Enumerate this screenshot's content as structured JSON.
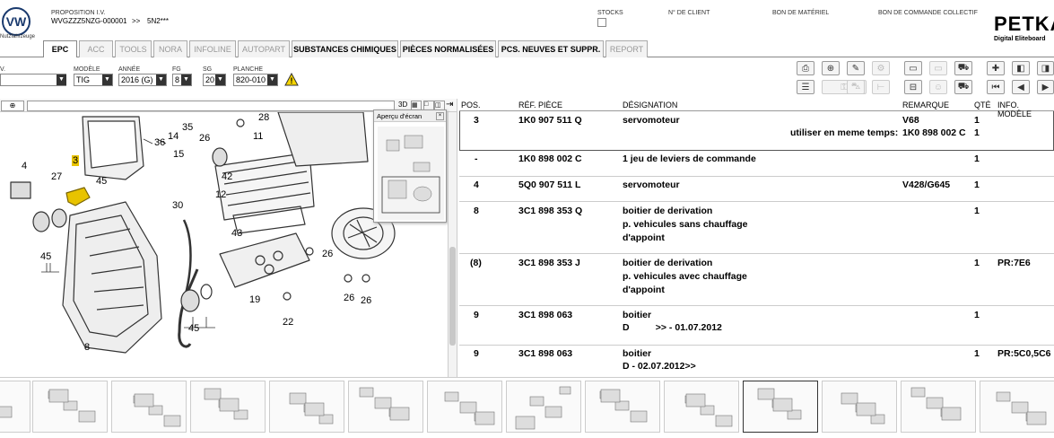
{
  "header": {
    "logo_sub": "Nutzfahrzeuge",
    "proposition_label": "PROPOSITION I.V.",
    "vin": "WVGZZZ5NZG-000001",
    "separator": ">>",
    "model_code": "5N2***",
    "stocks_label": "STOCKS",
    "client_label": "N° DE CLIENT",
    "materiel_label": "BON DE MATÉRIEL",
    "commande_label": "BON DE COMMANDE COLLECTIF",
    "petka": "PETKA",
    "petka_sub": "Digital Eliteboard"
  },
  "tabs": [
    {
      "label": "EPC",
      "state": "active"
    },
    {
      "label": "ACC",
      "state": "disabled"
    },
    {
      "label": "TOOLS",
      "state": "disabled"
    },
    {
      "label": "NORA",
      "state": "disabled"
    },
    {
      "label": "INFOLINE",
      "state": "disabled"
    },
    {
      "label": "AUTOPART",
      "state": "disabled"
    },
    {
      "label": "SUBSTANCES CHIMIQUES",
      "state": "enabled"
    },
    {
      "label": "PIÈCES NORMALISÉES",
      "state": "enabled"
    },
    {
      "label": "PCS. NEUVES ET SUPPR.",
      "state": "enabled"
    },
    {
      "label": "REPORT",
      "state": "disabled"
    }
  ],
  "selectors": {
    "v_label": "V.",
    "modele_label": "MODÈLE",
    "modele_value": "TIG",
    "annee_label": "ANNÉE",
    "annee_value": "2016 (G)",
    "fg_label": "FG",
    "fg_value": "8",
    "sg_label": "SG",
    "sg_value": "20",
    "planche_label": "PLANCHE",
    "planche_value": "820-010"
  },
  "preview": {
    "title": "Aperçu d'écran"
  },
  "table": {
    "headers": [
      "POS.",
      "RÉF. PIÈCE",
      "DÉSIGNATION",
      "REMARQUE",
      "QTÉ",
      "INFO. MODÈLE"
    ],
    "rows": [
      {
        "pos": "3",
        "ref": "1K0 907 511 Q",
        "desig": [
          "servomoteur"
        ],
        "remarque": "V68",
        "qty": "1",
        "info": "",
        "extra_label": "utiliser en meme temps:",
        "extra_ref": "1K0 898 002 C",
        "extra_qty": "1"
      },
      {
        "pos": "-",
        "ref": "1K0 898 002 C",
        "desig": [
          "1 jeu de leviers de commande"
        ],
        "remarque": "",
        "qty": "1",
        "info": ""
      },
      {
        "pos": "4",
        "ref": "5Q0 907 511 L",
        "desig": [
          "servomoteur"
        ],
        "remarque": "V428/G645",
        "qty": "1",
        "info": ""
      },
      {
        "pos": "8",
        "ref": "3C1 898 353 Q",
        "desig": [
          "boitier de derivation",
          "p. vehicules sans chauffage",
          "d'appoint"
        ],
        "remarque": "",
        "qty": "1",
        "info": ""
      },
      {
        "pos": "(8)",
        "ref": "3C1 898 353 J",
        "desig": [
          "boitier de derivation",
          "p. vehicules avec chauffage",
          "d'appoint"
        ],
        "remarque": "",
        "qty": "1",
        "info": "PR:7E6"
      },
      {
        "pos": "9",
        "ref": "3C1 898 063",
        "desig": [
          "boitier",
          "D          >> - 01.07.2012"
        ],
        "remarque": "",
        "qty": "1",
        "info": ""
      },
      {
        "pos": "9",
        "ref": "3C1 898 063",
        "desig": [
          "boitier",
          "D - 02.07.2012>>"
        ],
        "remarque": "",
        "qty": "1",
        "info": "PR:5C0,5C6"
      }
    ]
  },
  "diagram": {
    "callouts": [
      "28",
      "11",
      "14",
      "35",
      "36",
      "15",
      "26",
      "42",
      "12",
      "4",
      "27",
      "3",
      "45",
      "30",
      "43",
      "19",
      "26",
      "26",
      "26",
      "22",
      "45",
      "8",
      "45"
    ]
  },
  "colors": {
    "highlight": "#e8c300",
    "accent": "#1a3a6e"
  }
}
